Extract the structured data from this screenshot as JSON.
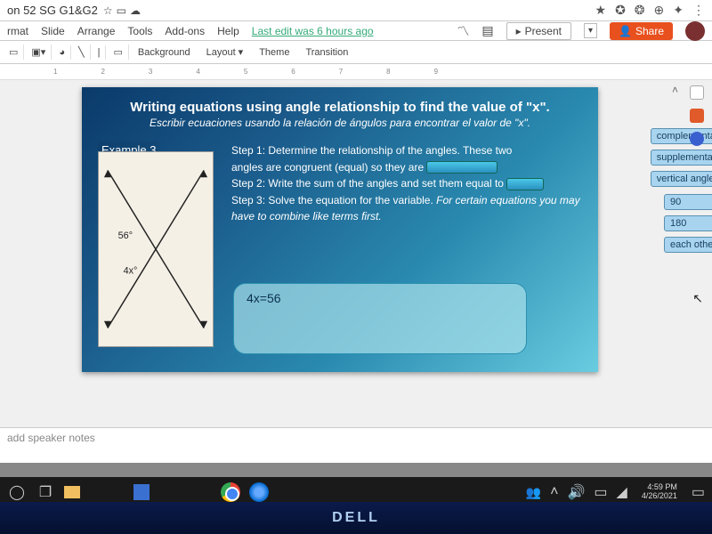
{
  "doc": {
    "title": "on 52 SG G1&G2"
  },
  "menu": {
    "items": [
      "rmat",
      "Slide",
      "Arrange",
      "Tools",
      "Add-ons",
      "Help"
    ],
    "lastedit": "Last edit was 6 hours ago"
  },
  "topbuttons": {
    "present": "Present",
    "share": "Share"
  },
  "toolbar": {
    "buttons": [
      "Background",
      "Layout ▾",
      "Theme",
      "Transition"
    ]
  },
  "ruler": [
    "1",
    "2",
    "3",
    "4",
    "5",
    "6",
    "7",
    "8",
    "9"
  ],
  "slide": {
    "title": "Writing equations using angle relationship to find the value of \"x\".",
    "subtitle": "Escribir ecuaciones usando la relación de ángulos para encontrar el valor de \"x\".",
    "example_label": "Example 3",
    "step1a": "Step 1: Determine the relationship of the angles. These two",
    "step1b": "angles are congruent (equal)  so they are",
    "step2": "Step 2: Write the sum of the angles and set them equal to",
    "step3": "Step 3: Solve the equation for the variable.",
    "step3b": "For certain equations you may have to combine like terms first.",
    "equation": "4x=56",
    "angle1": "56°",
    "angle2": "4x°"
  },
  "dragbank": {
    "top": [
      "complementary",
      "supplementary",
      "vertical angles"
    ],
    "mid": [
      "90",
      "180",
      "each other"
    ]
  },
  "speaker_notes_placeholder": "add speaker notes",
  "tray": {
    "time": "4:59 PM",
    "date": "4/26/2021"
  },
  "bezel": {
    "brand": "DELL"
  }
}
